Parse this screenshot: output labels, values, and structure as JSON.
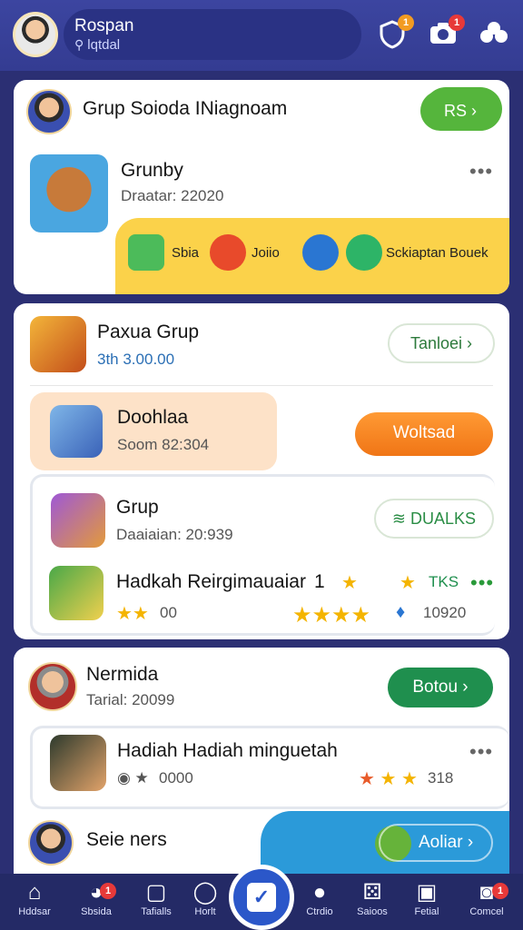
{
  "header": {
    "name": "Rospan",
    "subtitle": "lqtdal",
    "search_glyph": "⚲",
    "badges": {
      "shield": "1",
      "camera": "1"
    }
  },
  "card1": {
    "title": "Grup Soioda INiagnoam",
    "top_button": "RS",
    "item_title": "Grunby",
    "item_meta": "Draatar: 22020",
    "strip": {
      "a": "Sbia",
      "b": "Joiio",
      "c": "Sckiaptan Bouek"
    }
  },
  "card2": {
    "title": "Paxua Grup",
    "meta": "3th 3.00.00",
    "top_button": "Tanloei",
    "row1": {
      "title": "Doohlaa",
      "meta": "Soom 82:304",
      "button": "Woltsad"
    },
    "row2": {
      "title": "Grup",
      "meta": "Daaiaian: 20:939",
      "button": "DUALKS"
    },
    "row3": {
      "title": "Hadkah Reirgimauaiar",
      "tag": "1",
      "mini": "TKS",
      "score": "00",
      "count": "10920"
    }
  },
  "card3": {
    "title": "Nermida",
    "meta": "Tarial: 20099",
    "button": "Botou",
    "item_title": "Hadiah Hadiah minguetah",
    "item_meta": "0000",
    "item_score": "318",
    "bottom_title": "Seie ners",
    "bottom_button": "Aoliar"
  },
  "nav": {
    "items": [
      {
        "label": "Hddsar"
      },
      {
        "label": "Sbsida",
        "badge": "1"
      },
      {
        "label": "Tafialls"
      },
      {
        "label": "Horlt"
      },
      {
        "label": "Ctrdio"
      },
      {
        "label": "Saioos"
      },
      {
        "label": "Fetial"
      },
      {
        "label": "Comcel",
        "badge": "1"
      }
    ]
  },
  "colors": {
    "header_bg": "#3c45a0",
    "accent_green": "#55b53c",
    "accent_orange": "#f07516",
    "accent_yellow": "#fbd24a",
    "accent_blue": "#2b9ad9",
    "nav_bg": "#242a66"
  }
}
